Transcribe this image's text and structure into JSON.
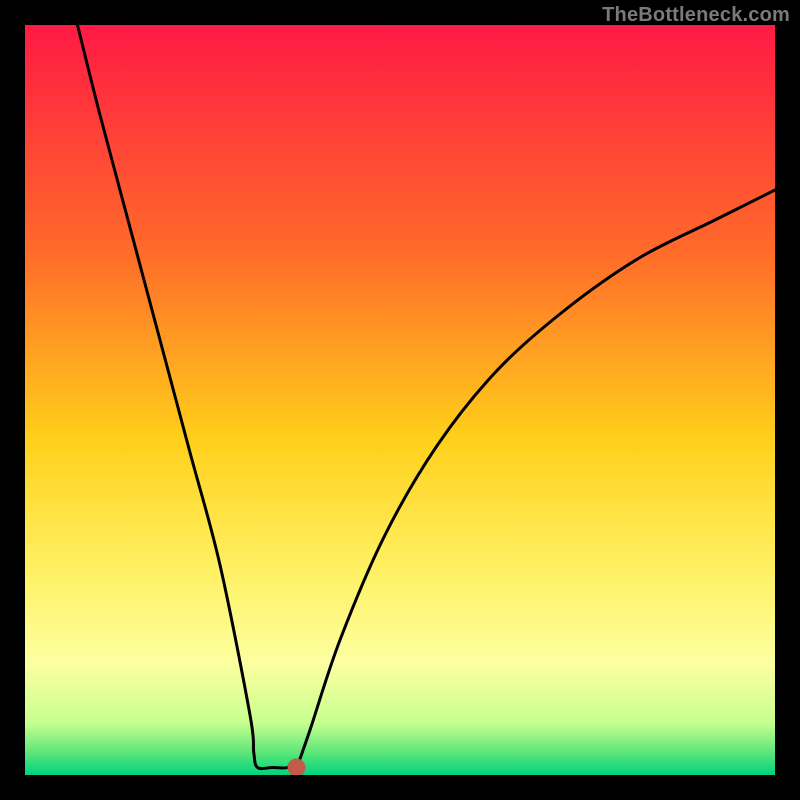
{
  "watermark": "TheBottleneck.com",
  "chart_data": {
    "type": "line",
    "title": "",
    "xlabel": "",
    "ylabel": "",
    "xlim": [
      0,
      100
    ],
    "ylim": [
      0,
      100
    ],
    "grid": false,
    "legend": false,
    "annotations": [],
    "background_gradient_stops": [
      {
        "offset": 0.0,
        "color": "#ff1a44"
      },
      {
        "offset": 0.3,
        "color": "#ff6a2a"
      },
      {
        "offset": 0.55,
        "color": "#ffcf1a"
      },
      {
        "offset": 0.72,
        "color": "#fff060"
      },
      {
        "offset": 0.85,
        "color": "#fdffa0"
      },
      {
        "offset": 0.93,
        "color": "#c8ff8f"
      },
      {
        "offset": 0.97,
        "color": "#5de67a"
      },
      {
        "offset": 1.0,
        "color": "#00d37e"
      }
    ],
    "series": [
      {
        "name": "bottleneck-curve",
        "x": [
          7.0,
          10.0,
          14.0,
          18.0,
          22.0,
          26.0,
          30.0,
          30.5,
          31.0,
          33.0,
          35.0,
          36.0,
          36.2,
          38.0,
          42.0,
          48.0,
          55.0,
          63.0,
          72.0,
          82.0,
          92.0,
          100.0
        ],
        "y": [
          100.0,
          88.0,
          73.0,
          58.0,
          43.0,
          28.0,
          8.0,
          3.0,
          1.0,
          1.0,
          1.0,
          2.0,
          1.0,
          6.0,
          18.0,
          32.0,
          44.0,
          54.0,
          62.0,
          69.0,
          74.0,
          78.0
        ]
      }
    ],
    "markers": [
      {
        "name": "optimal-point",
        "x": 36.2,
        "y": 1.0,
        "color": "#c45a4a",
        "radius": 9
      }
    ]
  }
}
